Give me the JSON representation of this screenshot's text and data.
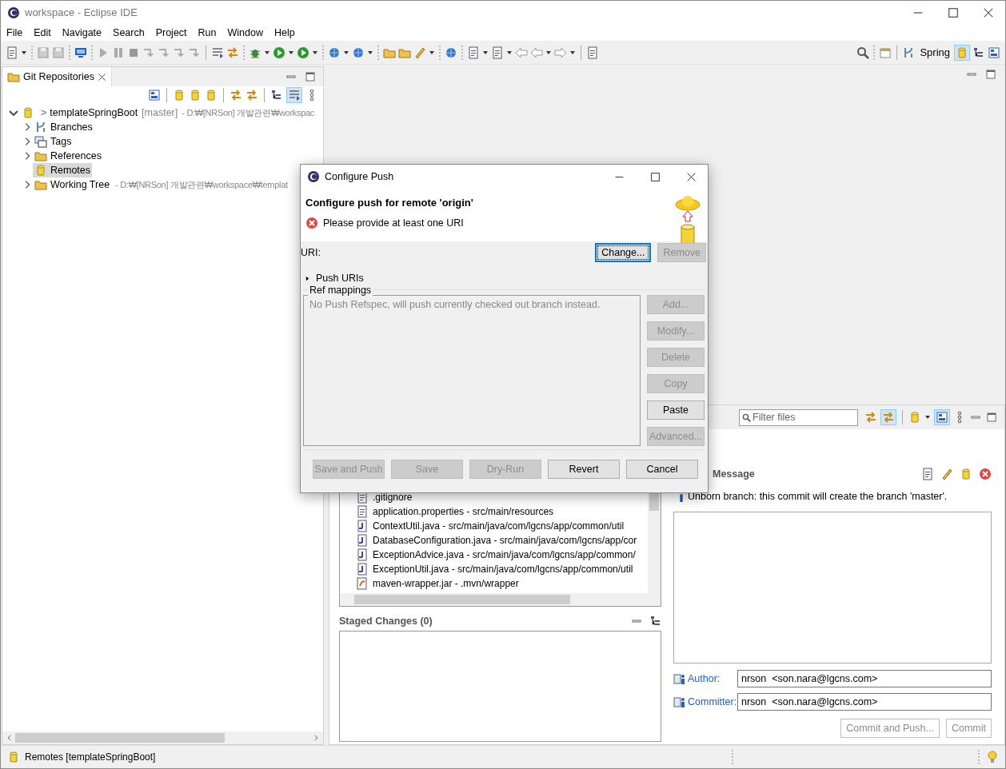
{
  "window": {
    "title": "workspace - Eclipse IDE"
  },
  "menu": [
    "File",
    "Edit",
    "Navigate",
    "Search",
    "Project",
    "Run",
    "Window",
    "Help"
  ],
  "perspectives": [
    {
      "label": "Spring",
      "selected": false
    }
  ],
  "git_repositories": {
    "tab": "Git Repositories",
    "tree": [
      {
        "label": "templateSpringBoot",
        "prefix": ">",
        "branch": "[master]",
        "path": "- D:₩[NRSon] 개발관련₩workspac",
        "expanded": true,
        "selected": false,
        "children": [
          {
            "label": "Branches",
            "kind": "branches",
            "has_children": true,
            "selected": false
          },
          {
            "label": "Tags",
            "kind": "tags",
            "has_children": true,
            "selected": false
          },
          {
            "label": "References",
            "kind": "folder",
            "has_children": true,
            "selected": false
          },
          {
            "label": "Remotes",
            "kind": "remote",
            "has_children": false,
            "selected": true
          },
          {
            "label": "Working Tree",
            "kind": "folder",
            "has_children": true,
            "selected": false,
            "path": "- D:₩[NRSon] 개발관련₩workspace₩templat"
          }
        ]
      }
    ]
  },
  "staging": {
    "filter_placeholder": "Filter files",
    "unstaged_files": [
      {
        "name": ".gitignore",
        "kind": "text"
      },
      {
        "name": "application.properties - src/main/resources",
        "kind": "text"
      },
      {
        "name": "ContextUtil.java - src/main/java/com/lgcns/app/common/util",
        "kind": "java"
      },
      {
        "name": "DatabaseConfiguration.java - src/main/java/com/lgcns/app/cor",
        "kind": "java"
      },
      {
        "name": "ExceptionAdvice.java - src/main/java/com/lgcns/app/common/",
        "kind": "java"
      },
      {
        "name": "ExceptionUtil.java - src/main/java/com/lgcns/app/common/util",
        "kind": "java"
      },
      {
        "name": "maven-wrapper.jar - .mvn/wrapper",
        "kind": "jar"
      }
    ],
    "staged_header": "Staged Changes (0)",
    "message_header": "Message",
    "info": "Unborn branch: this commit will create the branch 'master'.",
    "author_label": "Author:",
    "author": "nrson  <son.nara@lgcns.com>",
    "committer_label": "Committer:",
    "committer": "nrson  <son.nara@lgcns.com>",
    "buttons": [
      {
        "label": "Commit and Push...",
        "disabled": true
      },
      {
        "label": "Commit",
        "disabled": true
      }
    ]
  },
  "dialog": {
    "title": "Configure Push",
    "heading": "Configure push for remote 'origin'",
    "error": "Please provide at least one URI",
    "uri_label": "URI:",
    "uri_buttons": [
      {
        "label": "Change...",
        "disabled": false,
        "focused": true
      },
      {
        "label": "Remove",
        "disabled": true,
        "focused": false
      }
    ],
    "push_uris": {
      "label": "Push URIs",
      "expanded": false
    },
    "ref_mappings": {
      "label": "Ref mappings",
      "message": "No Push Refspec, will push currently checked out branch instead.",
      "buttons": [
        {
          "label": "Add...",
          "disabled": true
        },
        {
          "label": "Modify...",
          "disabled": true
        },
        {
          "label": "Delete",
          "disabled": true
        },
        {
          "label": "Copy",
          "disabled": true
        },
        {
          "label": "Paste",
          "disabled": false
        },
        {
          "label": "Advanced...",
          "disabled": true
        }
      ]
    },
    "footer_buttons": [
      {
        "label": "Save and Push",
        "disabled": true
      },
      {
        "label": "Save",
        "disabled": true
      },
      {
        "label": "Dry-Run",
        "disabled": true
      },
      {
        "label": "Revert",
        "disabled": false
      },
      {
        "label": "Cancel",
        "disabled": false
      }
    ]
  },
  "status_bar": {
    "text": "Remotes [templateSpringBoot]"
  }
}
